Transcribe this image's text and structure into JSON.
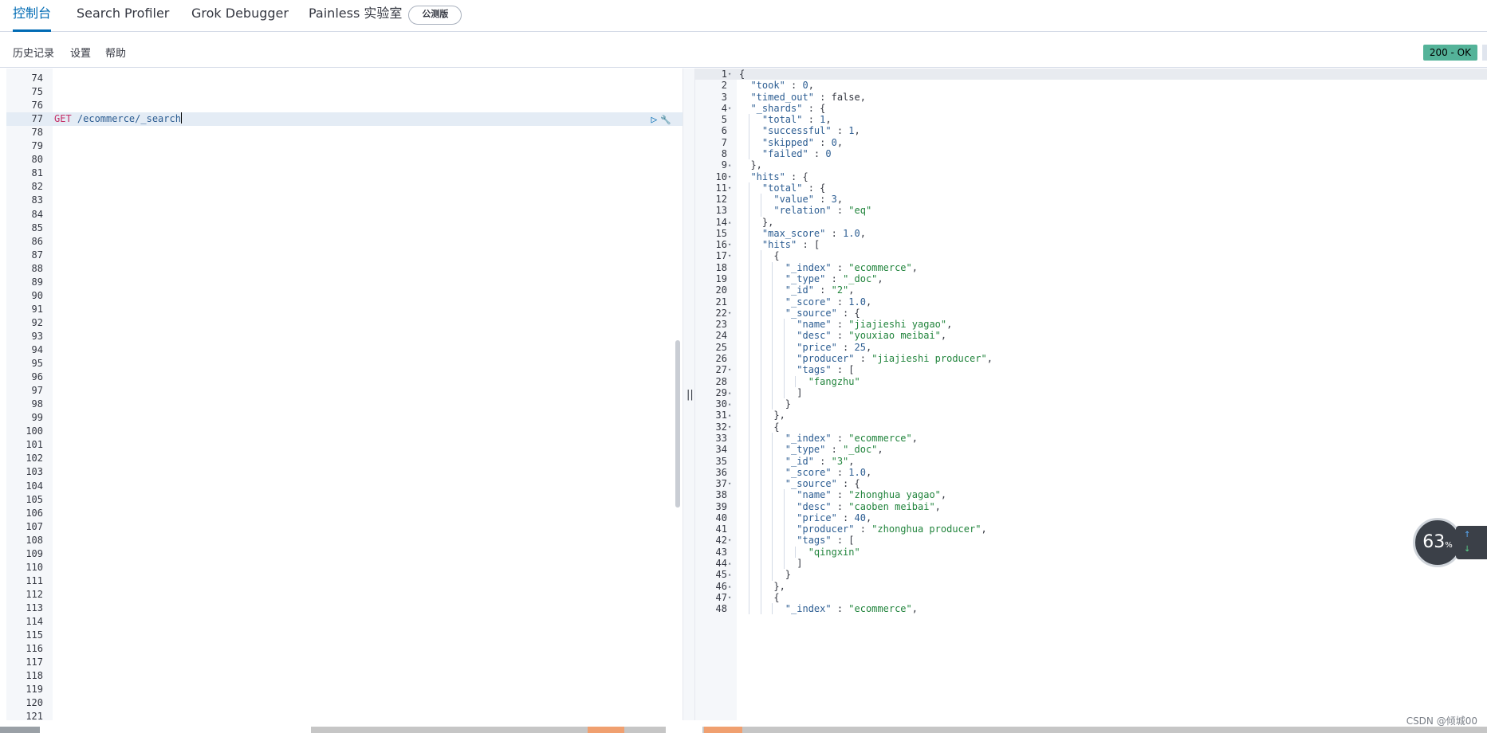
{
  "tabs": {
    "console": "控制台",
    "search_profiler": "Search Profiler",
    "grok_debugger": "Grok Debugger",
    "painless_lab": "Painless 实验室",
    "beta_badge": "公测版"
  },
  "menu": {
    "history": "历史记录",
    "settings": "设置",
    "help": "帮助"
  },
  "status": {
    "text": "200 - OK",
    "color": "#54b399"
  },
  "request_editor": {
    "first_line": 74,
    "last_line": 121,
    "active_line": 77,
    "request_line": 77,
    "method": "GET",
    "path": "/ecommerce/_search",
    "actions": [
      "play-icon",
      "wrench-icon"
    ]
  },
  "response_lines": [
    "{",
    "  \"took\" : 0,",
    "  \"timed_out\" : false,",
    "  \"_shards\" : {",
    "    \"total\" : 1,",
    "    \"successful\" : 1,",
    "    \"skipped\" : 0,",
    "    \"failed\" : 0",
    "  },",
    "  \"hits\" : {",
    "    \"total\" : {",
    "      \"value\" : 3,",
    "      \"relation\" : \"eq\"",
    "    },",
    "    \"max_score\" : 1.0,",
    "    \"hits\" : [",
    "      {",
    "        \"_index\" : \"ecommerce\",",
    "        \"_type\" : \"_doc\",",
    "        \"_id\" : \"2\",",
    "        \"_score\" : 1.0,",
    "        \"_source\" : {",
    "          \"name\" : \"jiajieshi yagao\",",
    "          \"desc\" : \"youxiao meibai\",",
    "          \"price\" : 25,",
    "          \"producer\" : \"jiajieshi producer\",",
    "          \"tags\" : [",
    "            \"fangzhu\"",
    "          ]",
    "        }",
    "      },",
    "      {",
    "        \"_index\" : \"ecommerce\",",
    "        \"_type\" : \"_doc\",",
    "        \"_id\" : \"3\",",
    "        \"_score\" : 1.0,",
    "        \"_source\" : {",
    "          \"name\" : \"zhonghua yagao\",",
    "          \"desc\" : \"caoben meibai\",",
    "          \"price\" : 40,",
    "          \"producer\" : \"zhonghua producer\",",
    "          \"tags\" : [",
    "            \"qingxin\"",
    "          ]",
    "        }",
    "      },",
    "      {",
    "        \"_index\" : \"ecommerce\","
  ],
  "fold_open_lines": [
    1,
    4,
    10,
    11,
    16,
    17,
    22,
    27,
    32,
    37,
    42,
    47
  ],
  "fold_close_lines": [
    9,
    14,
    29,
    30,
    31,
    44,
    45,
    46
  ],
  "divider_grip": "||",
  "speed_widget": {
    "value": "63",
    "unit": "%",
    "up": "↑",
    "down": "↓"
  },
  "watermark": "CSDN @倾城00"
}
